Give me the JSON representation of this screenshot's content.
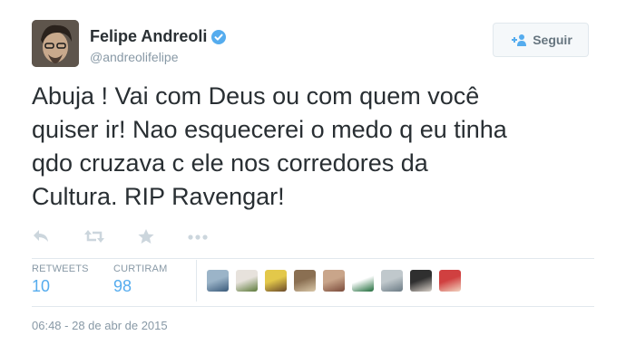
{
  "author": {
    "name": "Felipe Andreoli",
    "handle": "@andreolifelipe",
    "verified": true
  },
  "follow_button": {
    "label": "Seguir"
  },
  "tweet": {
    "lines": [
      "Abuja ! Vai com Deus ou com quem você",
      "quiser ir! Nao esquecerei o medo q eu tinha",
      "qdo cruzava c ele nos corredores da",
      "Cultura. RIP Ravengar!"
    ]
  },
  "actions": [
    "reply-icon",
    "retweet-icon",
    "favorite-icon",
    "more-icon"
  ],
  "stats": {
    "retweets": {
      "label": "RETWEETS",
      "value": "10"
    },
    "likes": {
      "label": "CURTIRAM",
      "value": "98"
    }
  },
  "likers": [
    {
      "colors": [
        "#9bb4c8",
        "#3a5a7a"
      ]
    },
    {
      "colors": [
        "#e7e2dc",
        "#5c7a3a"
      ]
    },
    {
      "colors": [
        "#e3c84a",
        "#6b4a2a"
      ]
    },
    {
      "colors": [
        "#8a6f52",
        "#d9c7a8"
      ]
    },
    {
      "colors": [
        "#c9a58a",
        "#7a4a3a"
      ]
    },
    {
      "colors": [
        "#ffffff",
        "#1e6b3a"
      ]
    },
    {
      "colors": [
        "#c0c8cc",
        "#6a7a84"
      ]
    },
    {
      "colors": [
        "#2f2f2f",
        "#d8d0c8"
      ]
    },
    {
      "colors": [
        "#d04040",
        "#f2d4c0"
      ]
    }
  ],
  "timestamp": "06:48 - 28 de abr de 2015",
  "colors": {
    "link_blue": "#55acee",
    "verified_blue": "#55acee",
    "muted": "#8899a6",
    "text": "#292f33"
  }
}
